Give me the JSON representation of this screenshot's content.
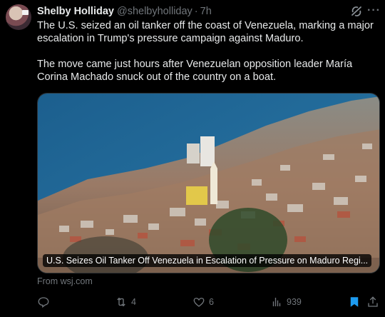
{
  "author": {
    "name": "Shelby Holliday",
    "handle": "@shelbyholliday",
    "separator": "·",
    "time": "7h"
  },
  "tweet": {
    "paragraphs": [
      "The U.S. seized an oil tanker off the coast of Venezuela, marking a major escalation in Trump's pressure campaign against Maduro.",
      "The move came just hours after Venezuelan opposition leader María Corina Machado snuck out of the country on a boat."
    ]
  },
  "card": {
    "caption": "U.S. Seizes Oil Tanker Off Venezuela in Escalation of Pressure on Maduro Regi...",
    "source": "From wsj.com"
  },
  "actions": {
    "reply_count": "",
    "repost_count": "4",
    "like_count": "6",
    "views_count": "939",
    "bookmarked": true
  },
  "icons": {
    "avatar": "avatar",
    "grok": "grok-icon",
    "more": "more-icon",
    "reply": "reply-icon",
    "repost": "repost-icon",
    "like": "like-icon",
    "views": "views-icon",
    "bookmark": "bookmark-icon",
    "share": "share-icon"
  },
  "colors": {
    "background": "#000000",
    "text": "#e7e9ea",
    "secondary": "#71767b",
    "accent": "#1d9bf0"
  }
}
